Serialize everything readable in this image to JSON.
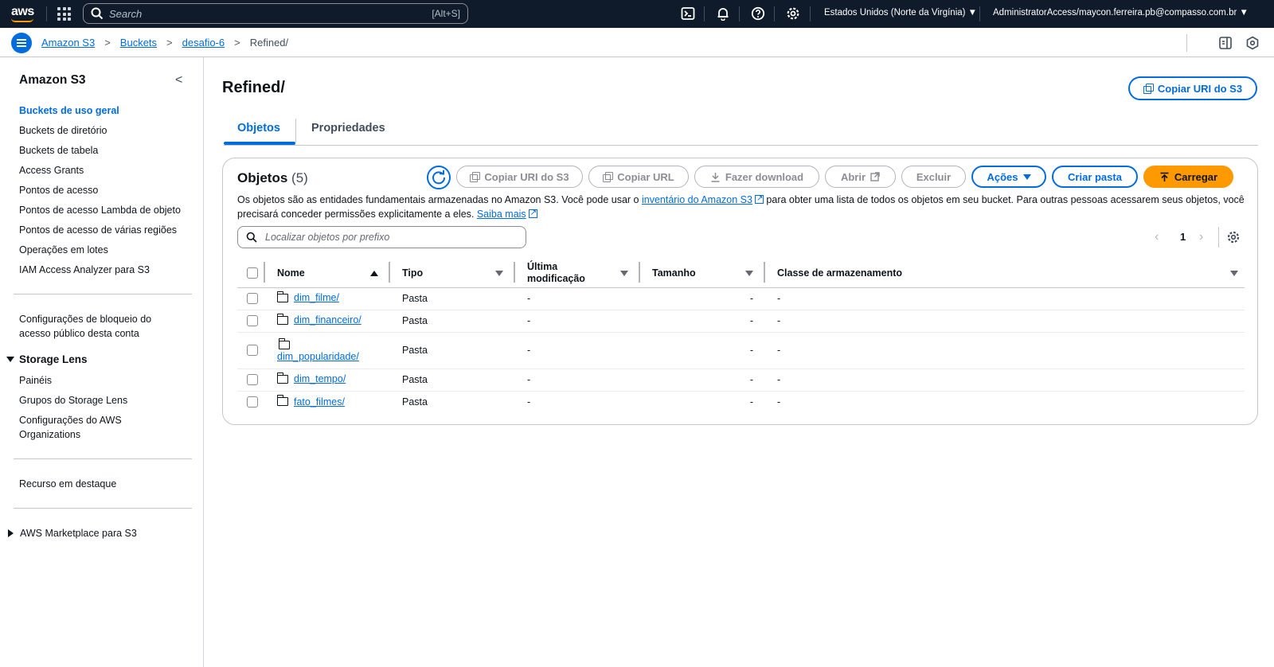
{
  "topbar": {
    "logo_text": "aws",
    "search_placeholder": "Search",
    "search_shortcut": "[Alt+S]",
    "region": "Estados Unidos (Norte da Virgínia) ▼",
    "account": "AdministratorAccess/maycon.ferreira.pb@compasso.com.br ▼",
    "icons": [
      "apps-grid-icon",
      "cloudshell-icon",
      "bell-icon",
      "help-icon",
      "settings-icon"
    ]
  },
  "breadcrumb": {
    "items": [
      "Amazon S3",
      "Buckets",
      "desafio-6"
    ],
    "current": "Refined/"
  },
  "sidebar": {
    "title": "Amazon S3",
    "items": [
      "Buckets de uso geral",
      "Buckets de diretório",
      "Buckets de tabela",
      "Access Grants",
      "Pontos de acesso",
      "Pontos de acesso Lambda de objeto",
      "Pontos de acesso de várias regiões",
      "Operações em lotes",
      "IAM Access Analyzer para S3"
    ],
    "block_settings": [
      "Configurações de bloqueio do",
      "acesso público desta conta"
    ],
    "storage_lens": {
      "title": "Storage Lens",
      "items": [
        "Painéis",
        "Grupos do Storage Lens"
      ],
      "org_lines": [
        "Configurações do AWS",
        "Organizations"
      ]
    },
    "featured": "Recurso em destaque",
    "marketplace": "AWS Marketplace para S3"
  },
  "page": {
    "title": "Refined/",
    "copy_uri_label": "Copiar URI do S3",
    "tabs": [
      "Objetos",
      "Propriedades"
    ]
  },
  "objects": {
    "title": "Objetos",
    "count": "(5)",
    "actions": {
      "copy_uri": "Copiar URI do S3",
      "copy_url": "Copiar URL",
      "download": "Fazer download",
      "open": "Abrir",
      "delete": "Excluir",
      "actions": "Ações",
      "create_folder": "Criar pasta",
      "upload": "Carregar"
    },
    "description": {
      "part1": "Os objetos são as entidades fundamentais armazenadas no Amazon S3. Você pode usar o ",
      "link1": "inventário do Amazon S3",
      "part2": " para obter uma lista de todos os objetos em seu bucket. Para outras pessoas acessarem seus objetos, você precisará conceder permissões explicitamente a eles. ",
      "link2": "Saiba mais"
    },
    "filter_placeholder": "Localizar objetos por prefixo",
    "page_number": "1",
    "columns": {
      "name": "Nome",
      "type": "Tipo",
      "modified_1": "Última",
      "modified_2": "modificação",
      "size": "Tamanho",
      "storage_class": "Classe de armazenamento"
    },
    "rows": [
      {
        "name": "dim_filme/",
        "type": "Pasta",
        "modified": "-",
        "size": "-",
        "storage_class": "-"
      },
      {
        "name": "dim_financeiro/",
        "type": "Pasta",
        "modified": "-",
        "size": "-",
        "storage_class": "-"
      },
      {
        "name": "dim_popularidade/",
        "type": "Pasta",
        "modified": "-",
        "size": "-",
        "storage_class": "-"
      },
      {
        "name": "dim_tempo/",
        "type": "Pasta",
        "modified": "-",
        "size": "-",
        "storage_class": "-"
      },
      {
        "name": "fato_filmes/",
        "type": "Pasta",
        "modified": "-",
        "size": "-",
        "storage_class": "-"
      }
    ]
  },
  "colors": {
    "topbar_bg": "#0f1b2a",
    "link": "#006ce0",
    "primary": "#ff9900"
  }
}
